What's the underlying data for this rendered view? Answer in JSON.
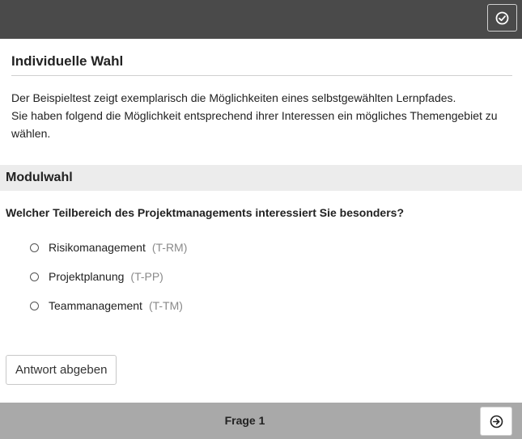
{
  "topbar": {
    "action_icon": "check-circle-icon",
    "bg_color": "#4a4a4a"
  },
  "section": {
    "title": "Individuelle Wahl",
    "intro_line1": "Der Beispieltest zeigt exemplarisch die Möglichkeiten eines selbstgewählten Lernpfades.",
    "intro_line2": "Sie haben folgend die Möglichkeit entsprechend ihrer Interessen ein mögliches Themengebiet zu wählen."
  },
  "module": {
    "title": "Modulwahl",
    "question": "Welcher Teilbereich des Projektmanagements interessiert Sie besonders?",
    "options": [
      {
        "label": "Risikomanagement",
        "code": "(T-RM)"
      },
      {
        "label": "Projektplanung",
        "code": "(T-PP)"
      },
      {
        "label": "Teammanagement",
        "code": "(T-TM)"
      }
    ],
    "submit_label": "Antwort abgeben"
  },
  "footer": {
    "label": "Frage 1",
    "next_icon": "arrow-right-circle-icon",
    "bg_color": "#a9a9a9"
  }
}
